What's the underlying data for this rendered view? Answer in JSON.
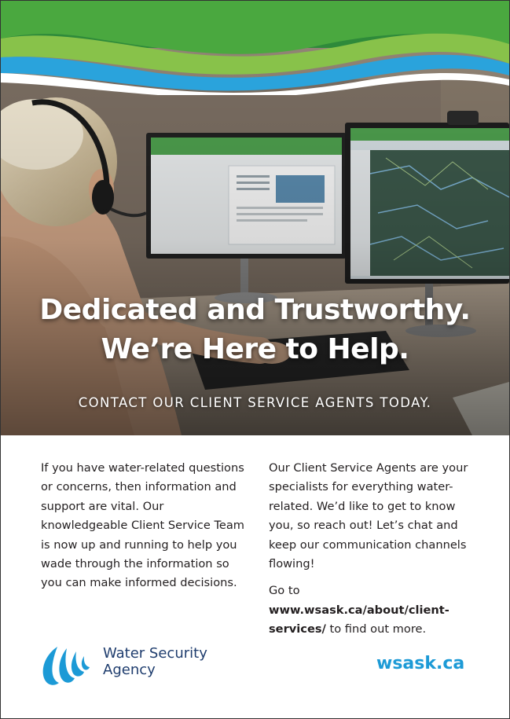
{
  "hero": {
    "headline_line1": "Dedicated and Trustworthy.",
    "headline_line2": "We’re Here to Help.",
    "tagline": "CONTACT OUR CLIENT SERVICE AGENTS TODAY."
  },
  "body": {
    "left_paragraph": "If you have water-related questions or concerns, then information and support are vital. Our knowledgeable Client Service Team is now up and running to help you wade through the information so you can make informed decisions.",
    "right_paragraph": "Our Client Service Agents are your specialists for everything water-related. We’d like to get to know you, so reach out! Let’s chat and keep our communication channels flowing!",
    "cta_prefix": "Go to ",
    "cta_link": "www.wsask.ca/about/client-services/",
    "cta_suffix": " to find out more."
  },
  "footer": {
    "logo_line1": "Water Security",
    "logo_line2": "Agency",
    "logo_icon": "water-drop-logo-icon",
    "website": "wsask.ca"
  },
  "colors": {
    "brand_blue": "#1c9ad6",
    "brand_navy": "#1f3d6e",
    "brand_green": "#3a9a3c",
    "text": "#231f20"
  }
}
